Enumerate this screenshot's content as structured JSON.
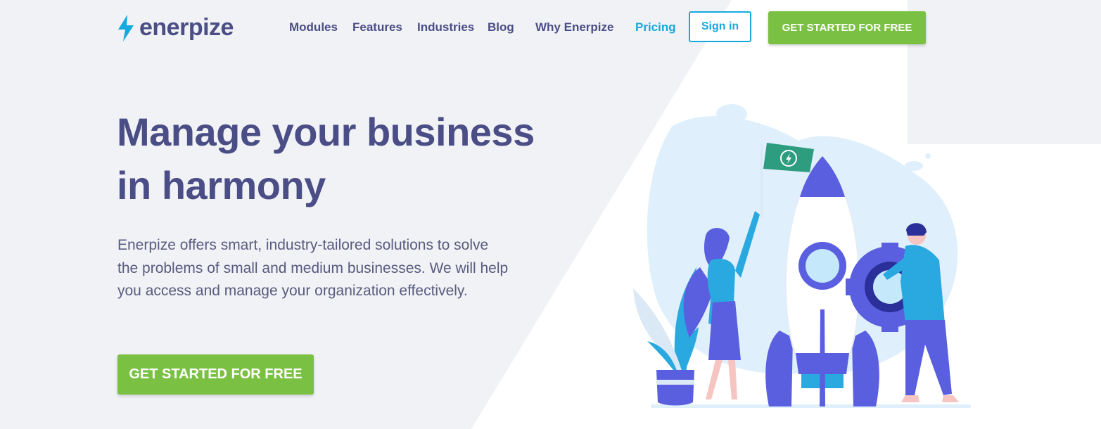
{
  "brand": {
    "name": "enerpize",
    "logo_icon": "lightning-bolt-icon",
    "logo_color": "#16a9df"
  },
  "nav": {
    "links": [
      {
        "label": "Modules",
        "active": false
      },
      {
        "label": "Features",
        "active": false
      },
      {
        "label": "Industries",
        "active": false
      },
      {
        "label": "Blog",
        "active": false
      },
      {
        "label": "Why Enerpize",
        "active": false
      },
      {
        "label": "Pricing",
        "active": true
      }
    ],
    "signin_label": "Sign in",
    "cta_label": "GET STARTED FOR FREE"
  },
  "hero": {
    "title_line1": "Manage your business",
    "title_line2": "in harmony",
    "description": "Enerpize offers smart, industry-tailored solutions to solve the problems of small and medium businesses. We will help you access and manage your organization effectively.",
    "cta_label": "GET STARTED FOR FREE"
  },
  "illustration": {
    "icons": [
      "rocket-icon",
      "flag-icon",
      "gear-icon",
      "plant-icon",
      "woman-figure",
      "man-figure"
    ]
  },
  "colors": {
    "primary": "#4b4d86",
    "accent": "#16a9df",
    "cta": "#7ac143",
    "background": "#f0f2f5",
    "illustration_purple": "#5a5fe0",
    "illustration_blue": "#1aa4e0"
  }
}
